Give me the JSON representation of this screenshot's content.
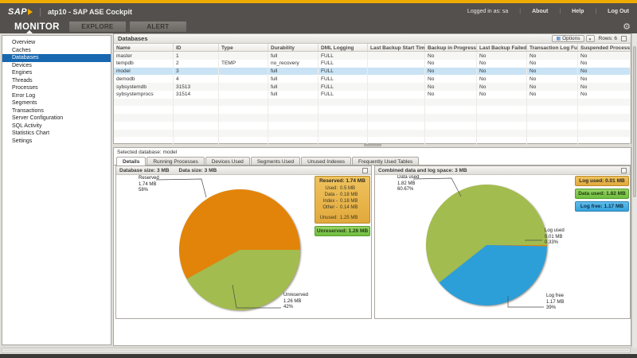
{
  "header": {
    "brand": "SAP",
    "window_title": "atp10 - SAP ASE Cockpit",
    "logged_in_as": "Logged in as: sa",
    "links": {
      "about": "About",
      "help": "Help",
      "log_out": "Log Out"
    },
    "nav_tabs": [
      {
        "label": "MONITOR",
        "active": true
      },
      {
        "label": "EXPLORE",
        "active": false
      },
      {
        "label": "ALERT",
        "active": false
      }
    ]
  },
  "sidebar": {
    "items": [
      {
        "label": "Overview",
        "selected": false
      },
      {
        "label": "Caches",
        "selected": false
      },
      {
        "label": "Databases",
        "selected": true
      },
      {
        "label": "Devices",
        "selected": false
      },
      {
        "label": "Engines",
        "selected": false
      },
      {
        "label": "Threads",
        "selected": false
      },
      {
        "label": "Processes",
        "selected": false
      },
      {
        "label": "Error Log",
        "selected": false
      },
      {
        "label": "Segments",
        "selected": false
      },
      {
        "label": "Transactions",
        "selected": false
      },
      {
        "label": "Server Configuration",
        "selected": false
      },
      {
        "label": "SQL Activity",
        "selected": false
      },
      {
        "label": "Statistics Chart",
        "selected": false
      },
      {
        "label": "Settings",
        "selected": false
      }
    ]
  },
  "databases_panel": {
    "title": "Databases",
    "toolbar": {
      "options_label": "Options",
      "rows_label": "Rows: 6"
    },
    "columns": [
      "Name",
      "ID",
      "Type",
      "Durability",
      "DML Logging",
      "Last Backup Start Time",
      "Backup in Progress",
      "Last Backup Failed",
      "Transaction Log Full",
      "Suspended Processes"
    ],
    "rows": [
      {
        "cells": [
          "master",
          "1",
          "",
          "full",
          "FULL",
          "",
          "No",
          "No",
          "No",
          "No"
        ],
        "selected": false
      },
      {
        "cells": [
          "tempdb",
          "2",
          "TEMP",
          "no_recovery",
          "FULL",
          "",
          "No",
          "No",
          "No",
          "No"
        ],
        "selected": false
      },
      {
        "cells": [
          "model",
          "3",
          "",
          "full",
          "FULL",
          "",
          "No",
          "No",
          "No",
          "No"
        ],
        "selected": true
      },
      {
        "cells": [
          "demodb",
          "4",
          "",
          "full",
          "FULL",
          "",
          "No",
          "No",
          "No",
          "No"
        ],
        "selected": false
      },
      {
        "cells": [
          "sybsystemdb",
          "31513",
          "",
          "full",
          "FULL",
          "",
          "No",
          "No",
          "No",
          "No"
        ],
        "selected": false
      },
      {
        "cells": [
          "sybsystemprocs",
          "31514",
          "",
          "full",
          "FULL",
          "",
          "No",
          "No",
          "No",
          "No"
        ],
        "selected": false
      }
    ]
  },
  "detail_panel": {
    "selected_database_label": "Selected database: model",
    "tabs": [
      {
        "label": "Details",
        "active": true
      },
      {
        "label": "Running Processes",
        "active": false
      },
      {
        "label": "Devices Used",
        "active": false
      },
      {
        "label": "Segments Used",
        "active": false
      },
      {
        "label": "Unused Indexes",
        "active": false
      },
      {
        "label": "Frequently Used Tables",
        "active": false
      }
    ]
  },
  "chart_data": [
    {
      "type": "pie",
      "panel_title_left": "Database size: 3 MB",
      "panel_title_right": "Data size: 3 MB",
      "start_deg": 90,
      "slices": [
        {
          "name": "Unreserved",
          "value": 42,
          "color": "#A3BC4F",
          "label_lines": [
            "Unreserved",
            "1.26 MB",
            "42%"
          ]
        },
        {
          "name": "Reserved",
          "value": 58,
          "color": "#E28409",
          "label_lines": [
            "Reserved",
            "1.74 MB",
            "58%"
          ]
        }
      ],
      "legend": {
        "header": "Reserved: 1.74 MB",
        "rows": [
          [
            "Used:",
            "0.5 MB"
          ],
          [
            "Data -",
            "0.18 MB"
          ],
          [
            "Index -",
            "0.18 MB"
          ],
          [
            "Other -",
            "0.14 MB"
          ],
          [
            "",
            ""
          ],
          [
            "Unused:",
            "1.25 MB"
          ]
        ],
        "footer": "Unreserved: 1.26 MB"
      }
    },
    {
      "type": "pie",
      "panel_title": "Combined data and log space: 3 MB",
      "start_deg": 90,
      "slices": [
        {
          "name": "Log used",
          "value": 0.33,
          "color": "#E28409",
          "label_lines": [
            "Log used",
            "0.01 MB",
            "0.33%"
          ]
        },
        {
          "name": "Log free",
          "value": 39,
          "color": "#2C9FD9",
          "label_lines": [
            "Log free",
            "1.17 MB",
            "39%"
          ]
        },
        {
          "name": "Data used",
          "value": 60.67,
          "color": "#A3BC4F",
          "label_lines": [
            "Data used",
            "1.82 MB",
            "60.67%"
          ]
        }
      ],
      "legend_boxes": [
        {
          "label": "Log used: 0.01 MB",
          "bg": "#ECB94F",
          "border": "#C08F2F"
        },
        {
          "label": "Data used: 1.82 MB",
          "bg": "#84CB58",
          "border": "#58A32F"
        },
        {
          "label": "Log free: 1.17 MB",
          "bg": "#45AEE4",
          "border": "#2F83B5"
        }
      ]
    }
  ]
}
